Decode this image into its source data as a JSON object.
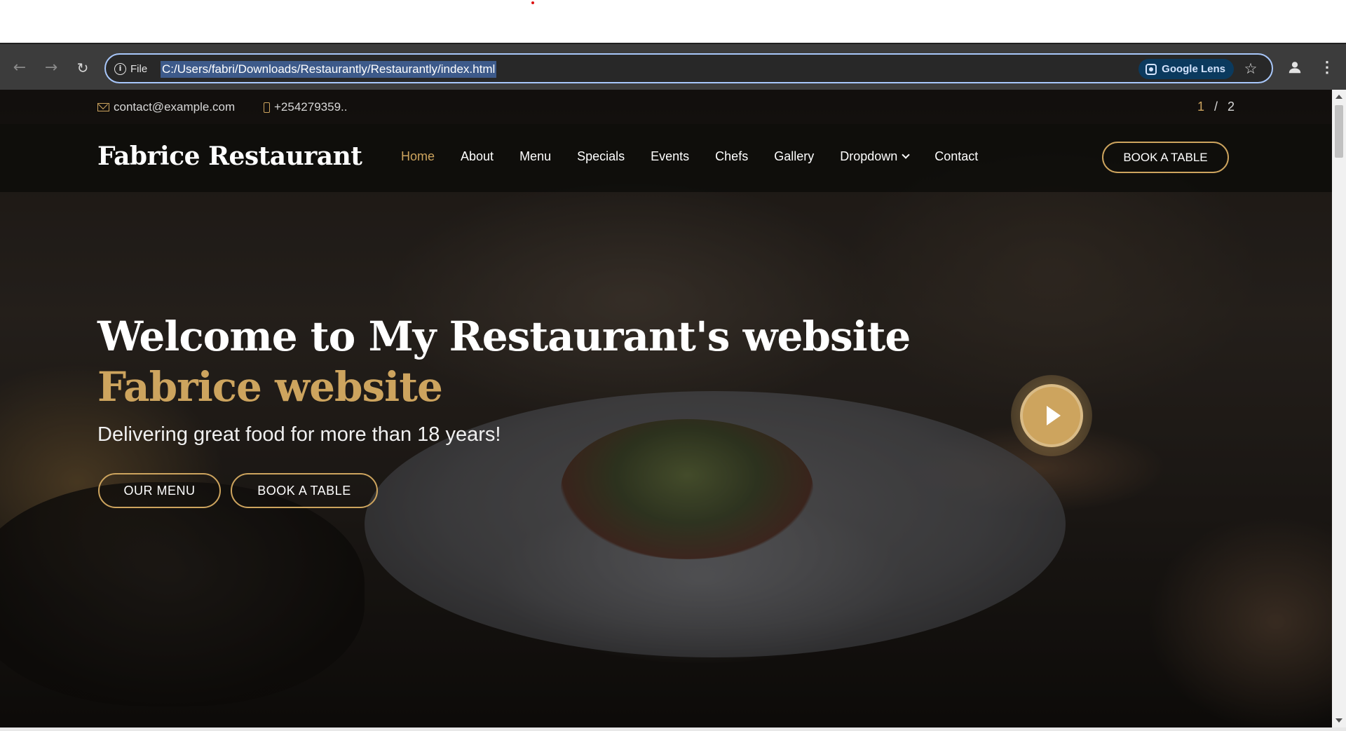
{
  "browser": {
    "site_info_label": "File",
    "url": "C:/Users/fabri/Downloads/Restaurantly/Restaurantly/index.html",
    "lens_label": "Google Lens",
    "back_icon": "←",
    "forward_icon": "→",
    "reload_icon": "↻",
    "star_icon": "☆",
    "menu_icon": "⋮"
  },
  "topbar": {
    "email": "contact@example.com",
    "phone": "+254279359..",
    "pager_current": "1",
    "pager_separator": "/",
    "pager_total": "2"
  },
  "header": {
    "logo": "Fabrice Restaurant",
    "nav": [
      {
        "label": "Home",
        "active": true
      },
      {
        "label": "About"
      },
      {
        "label": "Menu"
      },
      {
        "label": "Specials"
      },
      {
        "label": "Events"
      },
      {
        "label": "Chefs"
      },
      {
        "label": "Gallery"
      },
      {
        "label": "Dropdown",
        "has_caret": true
      },
      {
        "label": "Contact"
      }
    ],
    "book_button": "BOOK A TABLE"
  },
  "hero": {
    "title": "Welcome to My Restaurant's website",
    "subtitle": "Fabrice website",
    "tagline": "Delivering great food for more than 18 years!",
    "menu_button": "OUR MENU",
    "book_button": "BOOK A TABLE"
  },
  "colors": {
    "accent": "#cda45e",
    "header_bg": "#0c0b09",
    "browser_toolbar": "#3c3c3c",
    "omnibox_focus": "#a8c7fa"
  }
}
